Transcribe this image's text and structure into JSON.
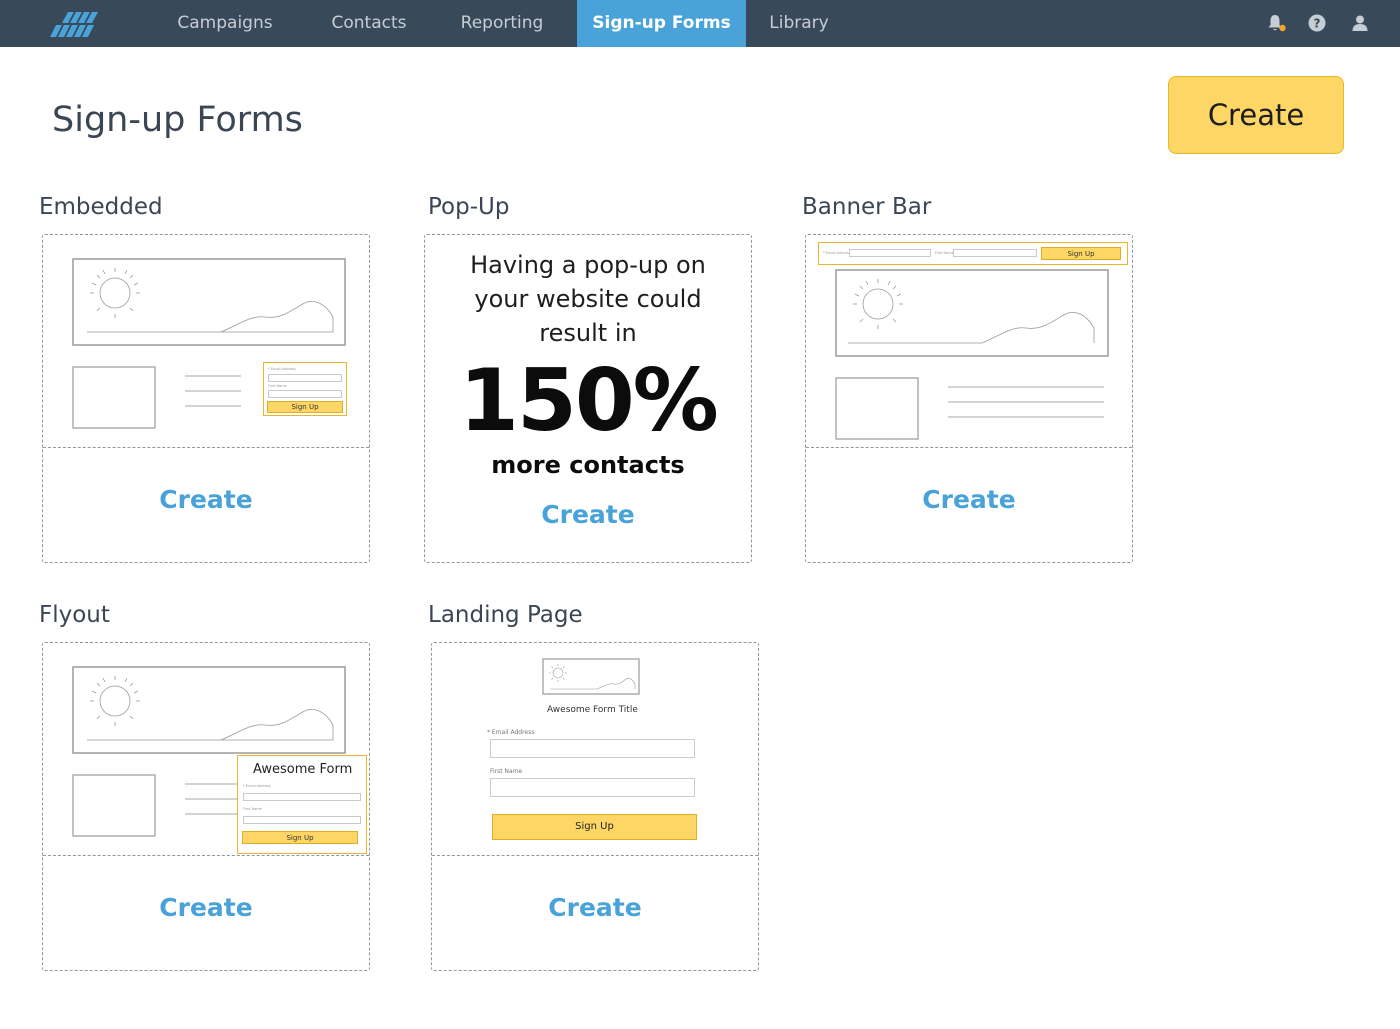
{
  "nav": {
    "items": [
      {
        "label": "Campaigns"
      },
      {
        "label": "Contacts"
      },
      {
        "label": "Reporting"
      },
      {
        "label": "Sign-up Forms"
      },
      {
        "label": "Library"
      }
    ],
    "icons": [
      "bell-icon",
      "help-icon",
      "user-icon"
    ],
    "notification_dot_color": "#f5a623"
  },
  "header": {
    "title": "Sign-up Forms",
    "create_label": "Create"
  },
  "colors": {
    "nav_bg": "#38495a",
    "nav_active": "#4aa3d8",
    "accent_yellow": "#fdd665",
    "link_blue": "#4aa3d8"
  },
  "sections": {
    "embedded": {
      "label": "Embedded",
      "create_label": "Create",
      "preview": {
        "email_label": "* Email Address",
        "first_name_label": "First Name",
        "button": "Sign Up"
      }
    },
    "popup": {
      "label": "Pop-Up",
      "line1": "Having a pop-up on",
      "line2": "your website could",
      "line3": "result in",
      "big": "150%",
      "more": "more contacts",
      "create_label": "Create"
    },
    "banner": {
      "label": "Banner Bar",
      "create_label": "Create",
      "preview": {
        "email_label": "* Email Address",
        "first_name_label": "First Name",
        "button": "Sign Up"
      }
    },
    "flyout": {
      "label": "Flyout",
      "create_label": "Create",
      "preview": {
        "title": "Awesome Form",
        "email_label": "* Email Address",
        "first_name_label": "First Name",
        "button": "Sign Up"
      }
    },
    "landing": {
      "label": "Landing Page",
      "create_label": "Create",
      "preview": {
        "title": "Awesome Form Title",
        "email_label": "* Email Address",
        "first_name_label": "First Name",
        "button": "Sign Up"
      }
    }
  }
}
